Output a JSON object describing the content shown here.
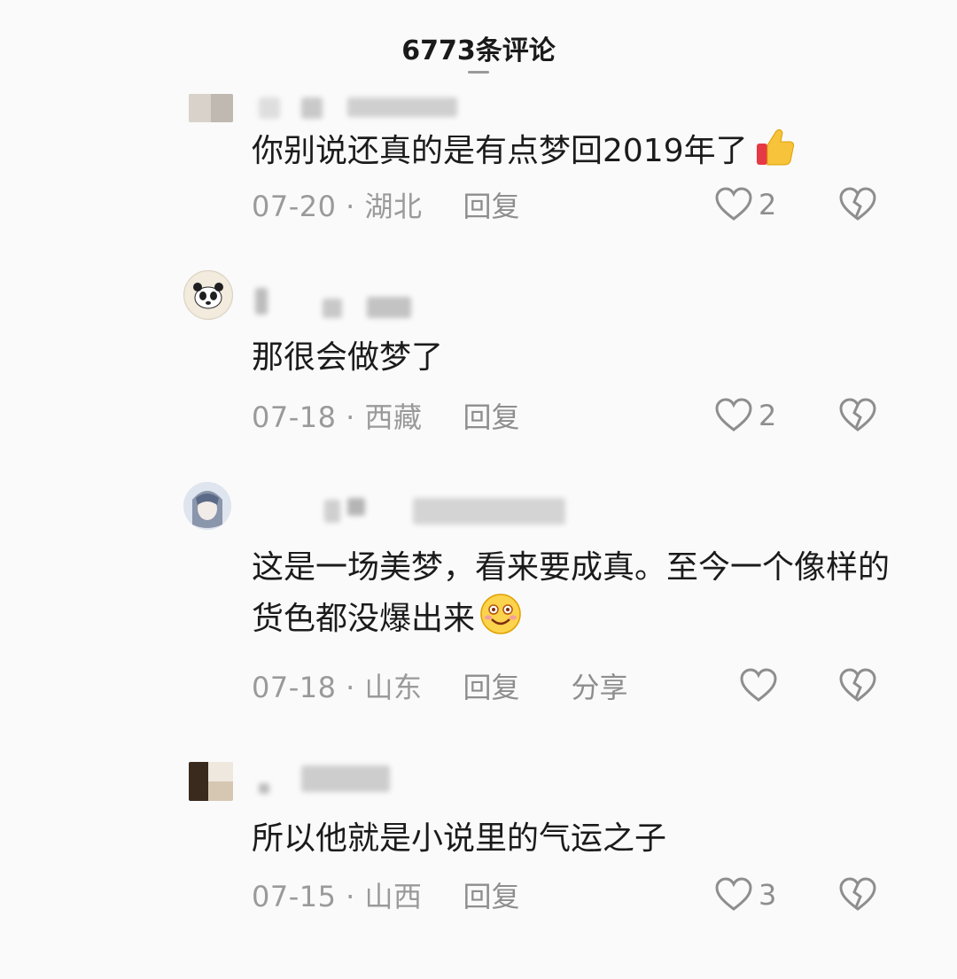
{
  "header": {
    "title": "6773条评论"
  },
  "comments": [
    {
      "text": "你别说还真的是有点梦回2019年了",
      "emoji": "thumbs-up-icon",
      "date": "07-20 · 湖北",
      "reply_label": "回复",
      "likes": "2"
    },
    {
      "text": "那很会做梦了",
      "date": "07-18 · 西藏",
      "reply_label": "回复",
      "likes": "2"
    },
    {
      "text": "这是一场美梦，看来要成真。至今一个像样的货色都没爆出来",
      "emoji": "grinning-face-icon",
      "date": "07-18 · 山东",
      "reply_label": "回复",
      "share_label": "分享",
      "likes": ""
    },
    {
      "text": "所以他就是小说里的气运之子",
      "date": "07-15 · 山西",
      "reply_label": "回复",
      "likes": "3"
    }
  ],
  "colors": {
    "background": "#fafafa",
    "text": "#1b1b1b",
    "meta": "#9a9a9a",
    "icon": "#8e8e8e"
  }
}
